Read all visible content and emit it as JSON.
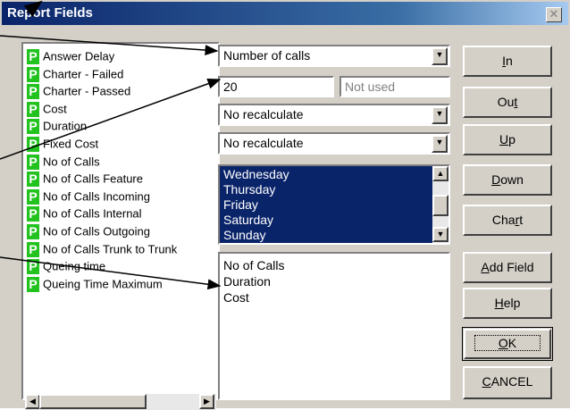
{
  "dialog": {
    "title": "Report Fields"
  },
  "fields": [
    "Answer Delay",
    "Charter - Failed",
    "Charter - Passed",
    "Cost",
    "Duration",
    "Fixed Cost",
    "No of Calls",
    "No of Calls Feature",
    "No of Calls Incoming",
    "No of Calls Internal",
    "No of Calls Outgoing",
    "No of Calls Trunk to Trunk",
    "Queing time",
    "Queing Time Maximum"
  ],
  "field_icon_letter": "P",
  "measure_combo": {
    "value": "Number of calls"
  },
  "threshold_input": {
    "value": "20"
  },
  "secondary_input": {
    "placeholder": "Not used"
  },
  "recalc_combo_1": {
    "value": "No recalculate"
  },
  "recalc_combo_2": {
    "value": "No recalculate"
  },
  "days_list": [
    "Wednesday",
    "Thursday",
    "Friday",
    "Saturday",
    "Sunday"
  ],
  "selected_fields": [
    "No of Calls",
    "Duration",
    "Cost"
  ],
  "buttons": {
    "in": {
      "pre": "",
      "u": "I",
      "post": "n"
    },
    "out": {
      "pre": "Ou",
      "u": "t",
      "post": ""
    },
    "up": {
      "pre": "",
      "u": "U",
      "post": "p"
    },
    "down": {
      "pre": "",
      "u": "D",
      "post": "own"
    },
    "chart": {
      "pre": "Cha",
      "u": "r",
      "post": "t"
    },
    "add_field": {
      "pre": "",
      "u": "A",
      "post": "dd Field"
    },
    "help": {
      "pre": "",
      "u": "H",
      "post": "elp"
    },
    "ok": {
      "pre": "",
      "u": "O",
      "post": "K"
    },
    "cancel": {
      "pre": "",
      "u": "C",
      "post": "ANCEL"
    }
  },
  "colors": {
    "title_bar": "#0a246a",
    "selection": "#0a246a",
    "field_icon": "#22c31e",
    "face": "#d4d0c8"
  }
}
